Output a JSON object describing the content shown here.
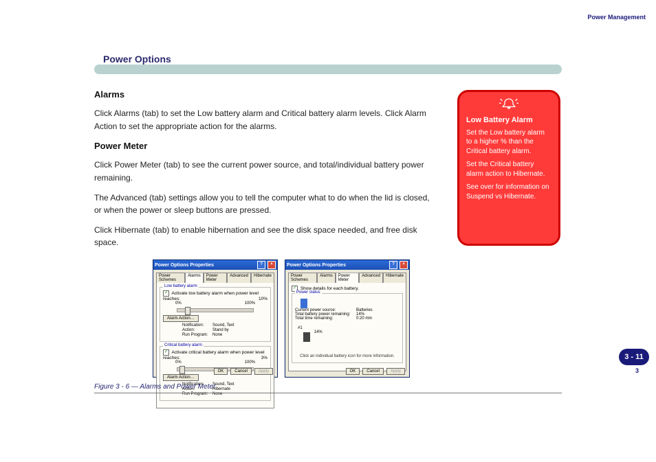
{
  "runhead": {
    "title": "Power Management"
  },
  "page_badge": "3 - 11",
  "chapter_no": "3",
  "section_title": "Power Options",
  "body": {
    "h_alarms": "Alarms",
    "p_alarms": "Click Alarms (tab) to set the Low battery alarm and Critical battery alarm levels. Click Alarm Action to set the appropriate action for the alarms.",
    "h_pm": "Power Meter",
    "p_pm": "Click Power Meter (tab) to see the current power source, and total/individual battery power remaining.",
    "p_advanced": "The Advanced (tab) settings allow you to tell the computer what to do when the lid is closed, or when the power or sleep buttons are pressed.",
    "p_hibernate": "Click Hibernate (tab) to enable hibernation and see the disk space needed, and free disk space."
  },
  "warning": {
    "title": "Low Battery Alarm",
    "p1": "Set the Low battery alarm to a higher % than the Critical battery alarm.",
    "p2": "Set the Critical battery alarm action to Hibernate.",
    "p3": "See over for information on Suspend vs Hibernate."
  },
  "dialog_common": {
    "title": "Power Options Properties",
    "ok": "OK",
    "cancel": "Cancel",
    "apply": "Apply"
  },
  "tabs": {
    "schemes": "Power Schemes",
    "alarms": "Alarms",
    "pm": "Power Meter",
    "advanced": "Advanced",
    "hibernate": "Hibernate"
  },
  "alarms_dlg": {
    "low_legend": "Low battery alarm",
    "low_chk": "Activate low battery alarm when power level reaches:",
    "low_val": "10%",
    "crit_legend": "Critical battery alarm",
    "crit_chk": "Activate critical battery alarm when power level reaches:",
    "crit_val": "3%",
    "zero": "0%",
    "hundred": "100%",
    "alarm_action_btn": "Alarm Action…",
    "k_notification": "Notification:",
    "k_action": "Action:",
    "k_run": "Run Program:",
    "low_notification": "Sound, Text",
    "low_action": "Stand by",
    "low_run": "None",
    "crit_notification": "Sound, Text",
    "crit_action": "Hibernate",
    "crit_run": "None"
  },
  "pm_dlg": {
    "details_chk": "Show details for each battery.",
    "ps_legend": "Power status",
    "k_src": "Current power source:",
    "v_src": "Batteries",
    "k_total": "Total battery power remaining:",
    "v_total": "14%",
    "k_time": "Total time remaining:",
    "v_time": "0:20 min",
    "b1_label": "#1",
    "b1_pct": "14%",
    "hint": "Click an individual battery icon for more information."
  },
  "figure_caption": "Figure 3 - 6 — Alarms and Power Meter",
  "chart_data": null
}
